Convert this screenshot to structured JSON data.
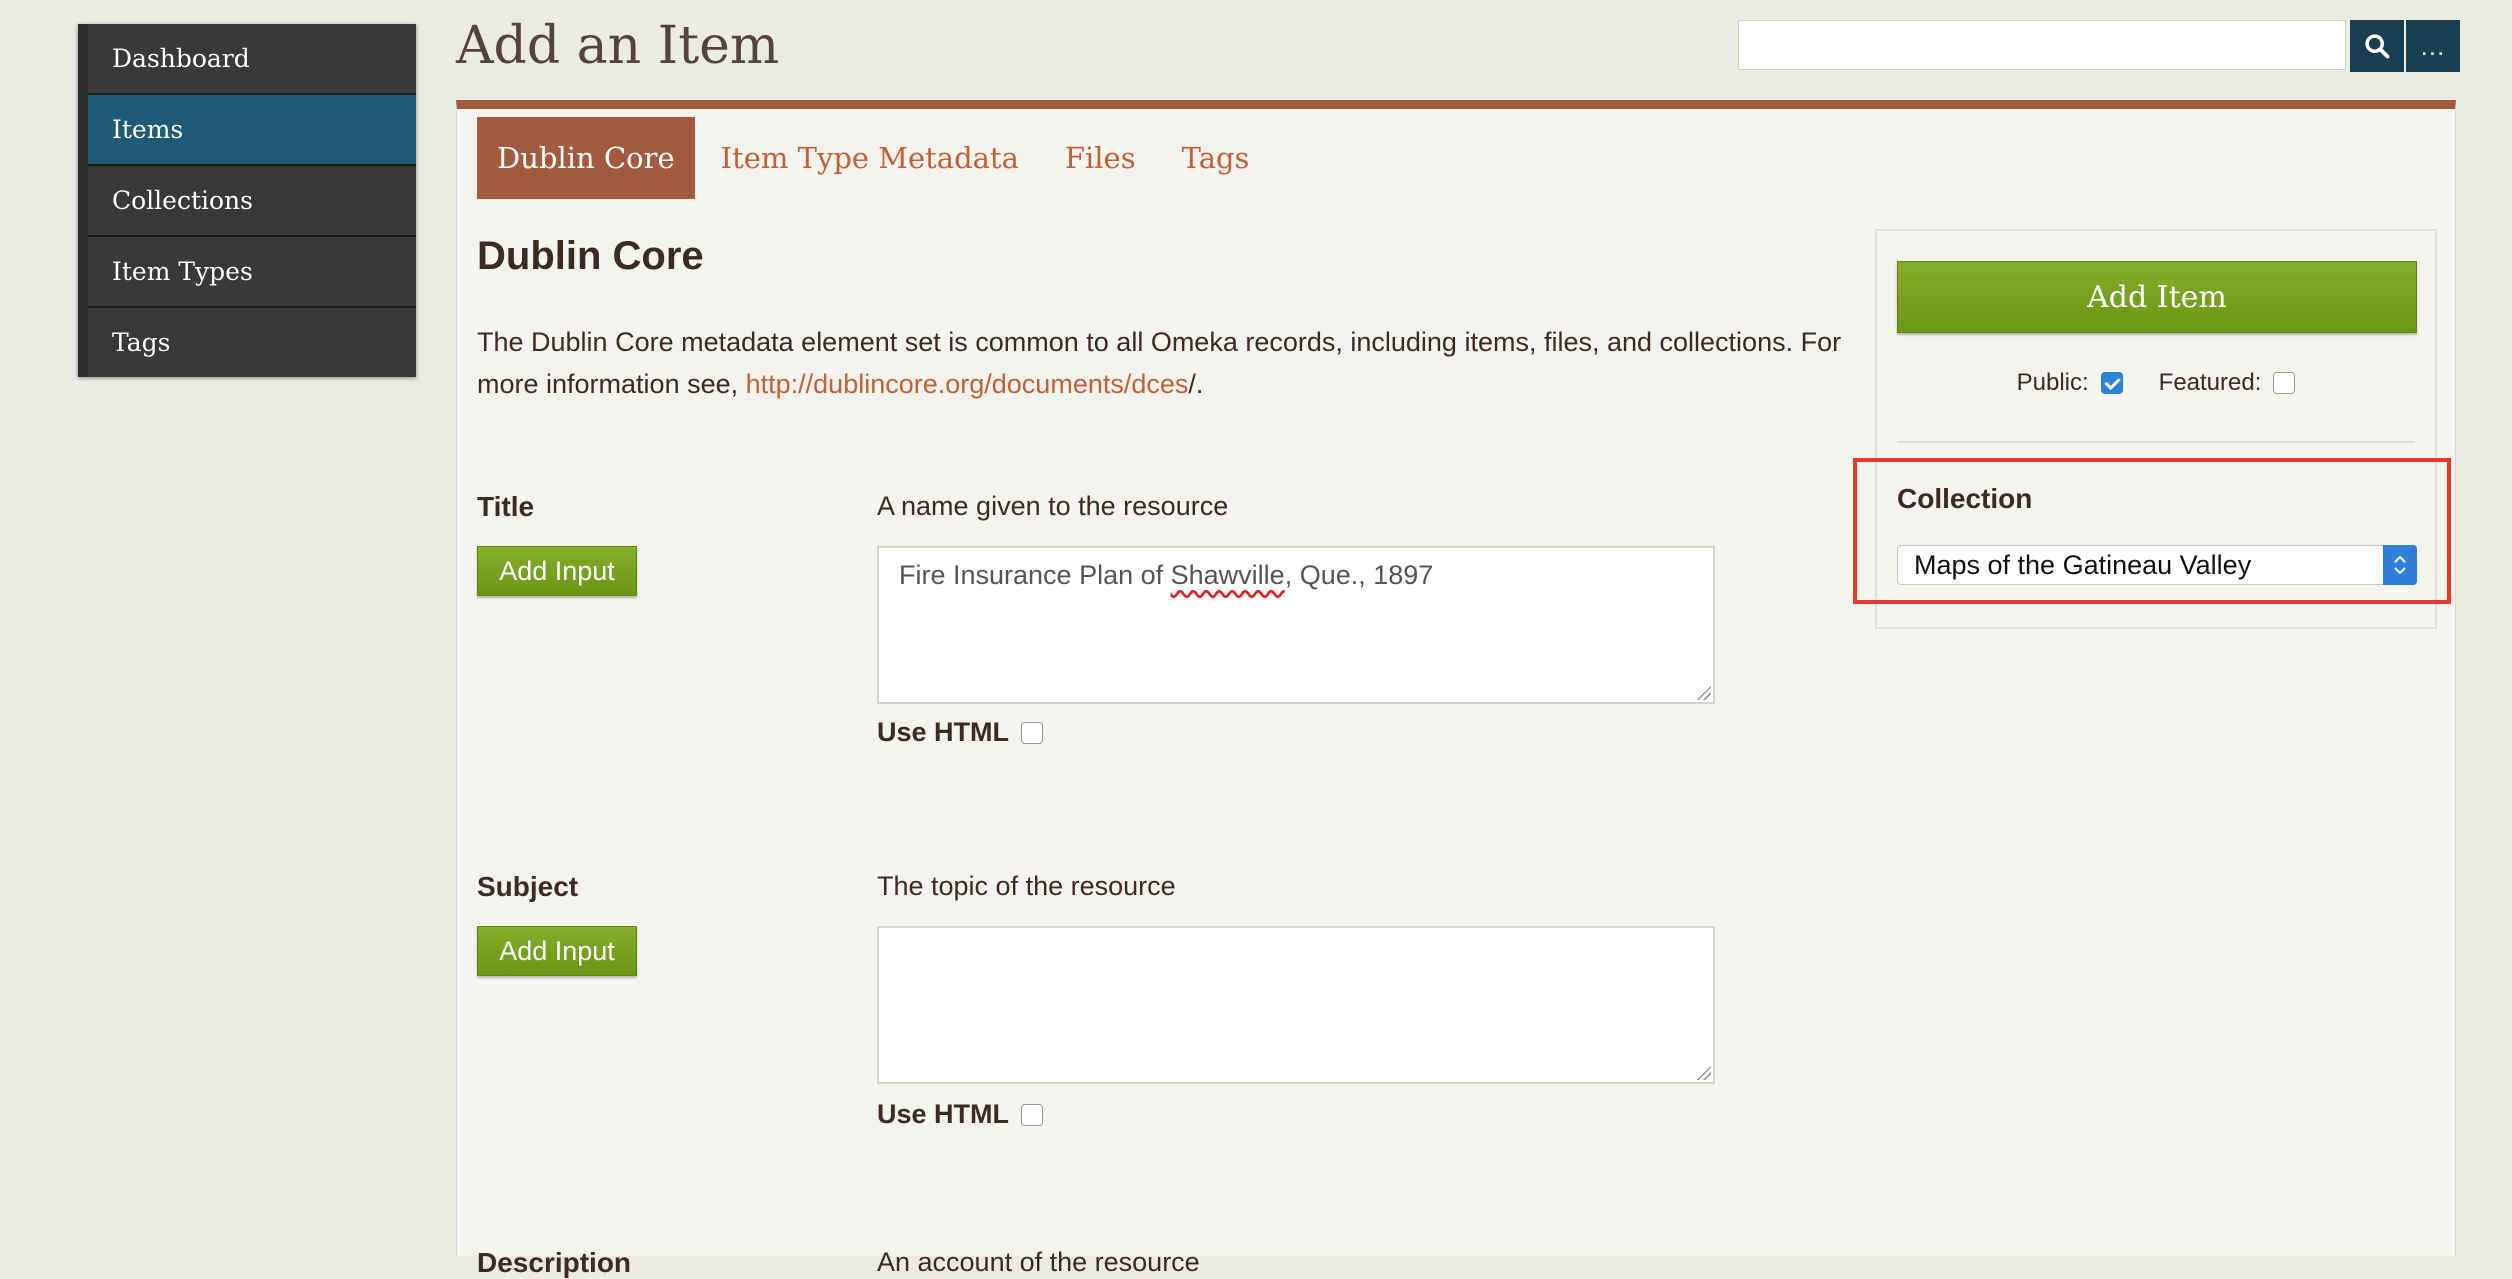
{
  "sidebar": {
    "items": [
      {
        "label": "Dashboard"
      },
      {
        "label": "Items"
      },
      {
        "label": "Collections"
      },
      {
        "label": "Item Types"
      },
      {
        "label": "Tags"
      }
    ],
    "active": "Items"
  },
  "page": {
    "title": "Add an Item"
  },
  "search": {
    "placeholder": "",
    "value": "",
    "advanced_label": "..."
  },
  "tabs": [
    {
      "label": "Dublin Core"
    },
    {
      "label": "Item Type Metadata"
    },
    {
      "label": "Files"
    },
    {
      "label": "Tags"
    }
  ],
  "section": {
    "title": "Dublin Core",
    "intro_text": "The Dublin Core metadata element set is common to all Omeka records, including items, files, and collections. For more information see, ",
    "intro_link": "http://dublincore.org/documents/dces",
    "intro_end": "/."
  },
  "fields": [
    {
      "label": "Title",
      "add_input": "Add Input",
      "description": "A name given to the resource",
      "value_pre": "Fire Insurance Plan of ",
      "value_misspelled": "Shawville",
      "value_post": ", Que., 1897",
      "use_html": "Use HTML"
    },
    {
      "label": "Subject",
      "add_input": "Add Input",
      "description": "The topic of the resource",
      "value": "",
      "use_html": "Use HTML"
    },
    {
      "label": "Description",
      "description": "An account of the resource"
    }
  ],
  "save_panel": {
    "add_item": "Add Item",
    "public_label": "Public:",
    "public_checked": true,
    "featured_label": "Featured:",
    "featured_checked": false,
    "collection_label": "Collection",
    "collection_selected": "Maps of the Gatineau Valley"
  },
  "colors": {
    "accent": "#a35b3e",
    "link": "#c1603a",
    "nav_active": "#1f5b74",
    "button_green": "#6b9516",
    "highlight": "#e23a2c"
  }
}
